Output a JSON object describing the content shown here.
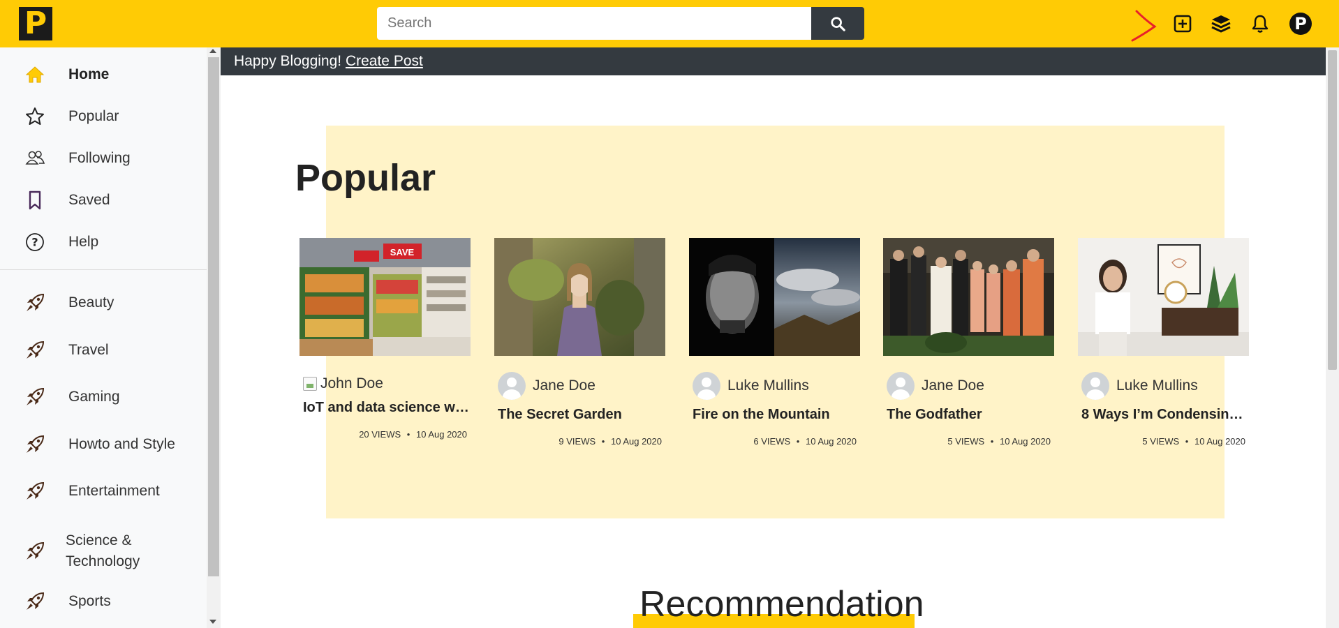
{
  "app": {
    "logo_letter": "P",
    "brand_color": "#ffcb05"
  },
  "search": {
    "placeholder": "Search",
    "value": "",
    "icon": "search-icon"
  },
  "header_icons": [
    {
      "name": "create-post-icon"
    },
    {
      "name": "layers-icon"
    },
    {
      "name": "bell-icon"
    },
    {
      "name": "profile-avatar",
      "letter": "P"
    }
  ],
  "sidebar": {
    "items": [
      {
        "label": "Home",
        "icon": "home-icon",
        "active": true
      },
      {
        "label": "Popular",
        "icon": "star-icon"
      },
      {
        "label": "Following",
        "icon": "people-icon"
      },
      {
        "label": "Saved",
        "icon": "bookmark-icon"
      },
      {
        "label": "Help",
        "icon": "help-icon"
      }
    ],
    "categories": [
      {
        "label": "Beauty",
        "icon": "rocket-icon"
      },
      {
        "label": "Travel",
        "icon": "rocket-icon"
      },
      {
        "label": "Gaming",
        "icon": "rocket-icon"
      },
      {
        "label": "Howto and Style",
        "icon": "rocket-icon"
      },
      {
        "label": "Entertainment",
        "icon": "rocket-icon"
      },
      {
        "label": "Science &",
        "label2": "Technology",
        "icon": "rocket-icon"
      },
      {
        "label": "Sports",
        "icon": "rocket-icon"
      }
    ]
  },
  "banner": {
    "text": "Happy Blogging! ",
    "link": "Create Post"
  },
  "popular": {
    "title": "Popular",
    "posts": [
      {
        "author": "John Doe",
        "title": "IoT and data science wi…",
        "views": "20 VIEWS",
        "date": "10 Aug 2020"
      },
      {
        "author": "Jane Doe",
        "title": "The Secret Garden",
        "views": "9 VIEWS",
        "date": "10 Aug 2020"
      },
      {
        "author": "Luke Mullins",
        "title": "Fire on the Mountain",
        "views": "6 VIEWS",
        "date": "10 Aug 2020"
      },
      {
        "author": "Jane Doe",
        "title": "The Godfather",
        "views": "5 VIEWS",
        "date": "10 Aug 2020"
      },
      {
        "author": "Luke Mullins",
        "title": "8 Ways I’m Condensin…",
        "views": "5 VIEWS",
        "date": "10 Aug 2020"
      }
    ]
  },
  "recommendation": {
    "title": "Recommendation"
  },
  "separator": "•"
}
